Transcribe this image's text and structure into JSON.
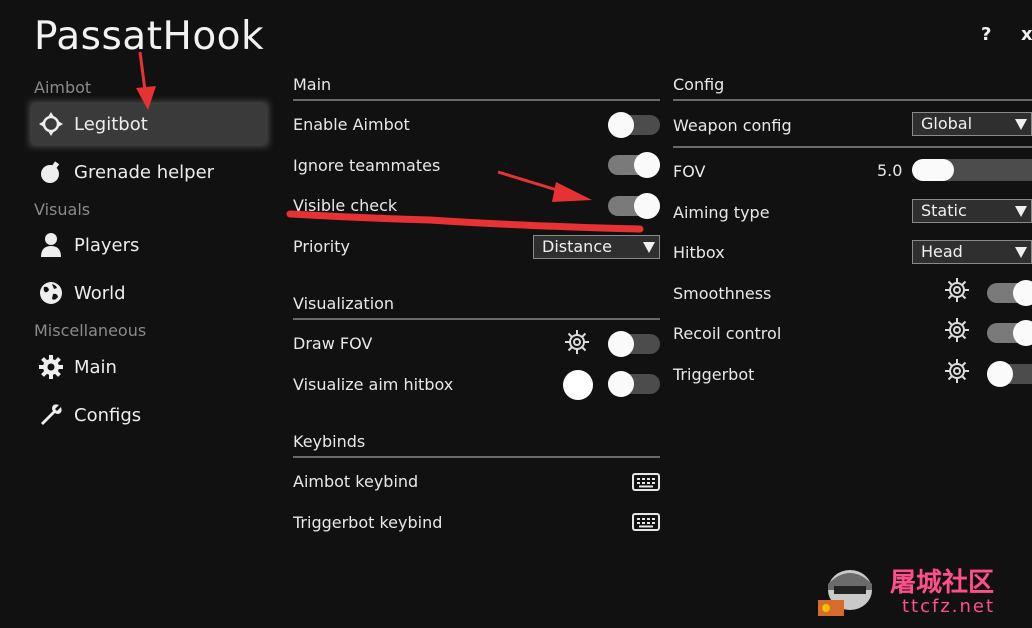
{
  "app": {
    "title": "PassatHook",
    "help_label": "?",
    "close_label": "x"
  },
  "sidebar": {
    "sections": [
      "Aimbot",
      "Visuals",
      "Miscellaneous"
    ],
    "items": [
      {
        "label": "Legitbot",
        "icon": "crosshair-icon",
        "active": true
      },
      {
        "label": "Grenade helper",
        "icon": "grenade-icon",
        "active": false
      },
      {
        "label": "Players",
        "icon": "user-icon",
        "active": false
      },
      {
        "label": "World",
        "icon": "globe-icon",
        "active": false
      },
      {
        "label": "Main",
        "icon": "gear-icon",
        "active": false
      },
      {
        "label": "Configs",
        "icon": "wrench-icon",
        "active": false
      }
    ]
  },
  "main": {
    "heading": "Main",
    "enable_aimbot": {
      "label": "Enable Aimbot",
      "on": false
    },
    "ignore_teammates": {
      "label": "Ignore teammates",
      "on": true
    },
    "visible_check": {
      "label": "Visible check",
      "on": true
    },
    "priority": {
      "label": "Priority",
      "value": "Distance"
    }
  },
  "visualization": {
    "heading": "Visualization",
    "draw_fov": {
      "label": "Draw FOV",
      "on": false
    },
    "visualize_aim_hitbox": {
      "label": "Visualize aim hitbox",
      "on": false,
      "color": "#ffffff"
    }
  },
  "keybinds": {
    "heading": "Keybinds",
    "aimbot": {
      "label": "Aimbot keybind",
      "icon": "keyboard-icon"
    },
    "triggerbot": {
      "label": "Triggerbot keybind",
      "icon": "keyboard-icon"
    }
  },
  "config": {
    "heading": "Config",
    "weapon_config": {
      "label": "Weapon config",
      "value": "Global"
    },
    "fov": {
      "label": "FOV",
      "value": "5.0"
    },
    "aiming_type": {
      "label": "Aiming type",
      "value": "Static"
    },
    "hitbox": {
      "label": "Hitbox",
      "value": "Head"
    },
    "smoothness": {
      "label": "Smoothness",
      "on": true
    },
    "recoil_control": {
      "label": "Recoil control",
      "on": true
    },
    "triggerbot": {
      "label": "Triggerbot",
      "on": false
    }
  },
  "watermark": {
    "text": "屠城社区",
    "sub": "ttcfz.net"
  },
  "colors": {
    "background": "#111111",
    "annotation": "#e63232",
    "toggle_knob": "#fafafa",
    "watermark": "#ff4f8a"
  }
}
